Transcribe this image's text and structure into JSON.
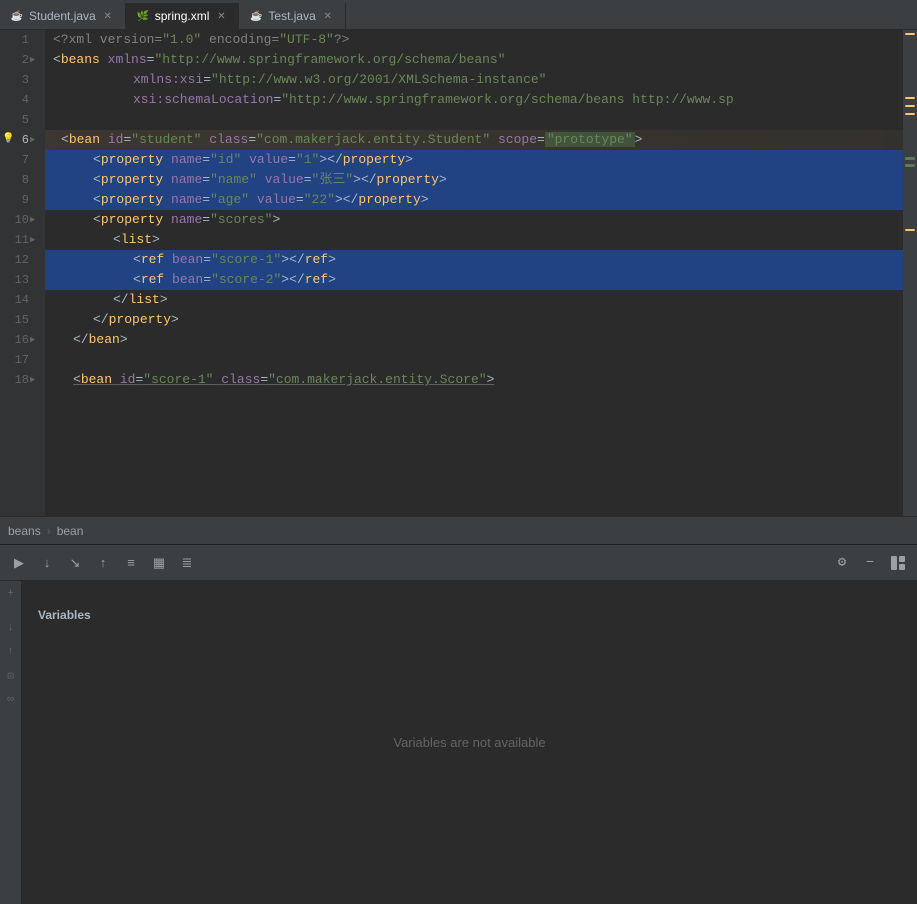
{
  "tabs": [
    {
      "id": "student",
      "label": "Student.java",
      "icon": "☕",
      "active": false,
      "color": "#4a9eff"
    },
    {
      "id": "spring",
      "label": "spring.xml",
      "icon": "🌿",
      "active": true,
      "color": "#6a8759"
    },
    {
      "id": "test",
      "label": "Test.java",
      "icon": "☕",
      "active": false,
      "color": "#4a9eff"
    }
  ],
  "code_lines": [
    {
      "num": 1,
      "indent": 4,
      "content": "xml_decl",
      "raw": "<?xml version=\"1.0\" encoding=\"UTF-8\"?>"
    },
    {
      "num": 2,
      "indent": 4,
      "content": "beans_open",
      "raw": "<beans xmlns=\"http://www.springframework.org/schema/beans\""
    },
    {
      "num": 3,
      "indent": 16,
      "content": "xmlns_xsi",
      "raw": "xmlns:xsi=\"http://www.w3.org/2001/XMLSchema-instance\""
    },
    {
      "num": 4,
      "indent": 16,
      "content": "xsi_schema",
      "raw": "xsi:schemaLocation=\"http://www.springframework.org/schema/beans http://www.sp"
    },
    {
      "num": 5,
      "indent": 0,
      "content": "empty",
      "raw": ""
    },
    {
      "num": 6,
      "indent": 4,
      "content": "bean_open",
      "raw": "<bean id=\"student\" class=\"com.makerjack.entity.Student\" scope=\"prototype\">"
    },
    {
      "num": 7,
      "indent": 12,
      "content": "prop_id",
      "raw": "<property name=\"id\" value=\"1\"></property>"
    },
    {
      "num": 8,
      "indent": 12,
      "content": "prop_name",
      "raw": "<property name=\"name\" value=\"张三\"></property>"
    },
    {
      "num": 9,
      "indent": 12,
      "content": "prop_age",
      "raw": "<property name=\"age\" value=\"22\"></property>"
    },
    {
      "num": 10,
      "indent": 12,
      "content": "prop_scores_open",
      "raw": "<property name=\"scores\">"
    },
    {
      "num": 11,
      "indent": 20,
      "content": "list_open",
      "raw": "<list>"
    },
    {
      "num": 12,
      "indent": 28,
      "content": "ref1",
      "raw": "<ref bean=\"score-1\"></ref>"
    },
    {
      "num": 13,
      "indent": 28,
      "content": "ref2",
      "raw": "<ref bean=\"score-2\"></ref>"
    },
    {
      "num": 14,
      "indent": 20,
      "content": "list_close",
      "raw": "</list>"
    },
    {
      "num": 15,
      "indent": 12,
      "content": "prop_close",
      "raw": "</property>"
    },
    {
      "num": 16,
      "indent": 8,
      "content": "bean_close",
      "raw": "</bean>"
    },
    {
      "num": 17,
      "indent": 0,
      "content": "empty",
      "raw": ""
    },
    {
      "num": 18,
      "indent": 8,
      "content": "bean2_open",
      "raw": "<bean id=\"score-1\" class=\"com.makerjack.entity.Score\">"
    }
  ],
  "breadcrumb": {
    "items": [
      "beans",
      "bean"
    ]
  },
  "bottom_panel": {
    "title": "Variables",
    "empty_message": "Variables are not available",
    "toolbar_buttons": [
      "▼",
      "↓",
      "↑",
      "⬆",
      "≡",
      "▦",
      "≣"
    ],
    "settings_icon": "⚙",
    "minus_icon": "−",
    "layout_icon": "⊟"
  }
}
